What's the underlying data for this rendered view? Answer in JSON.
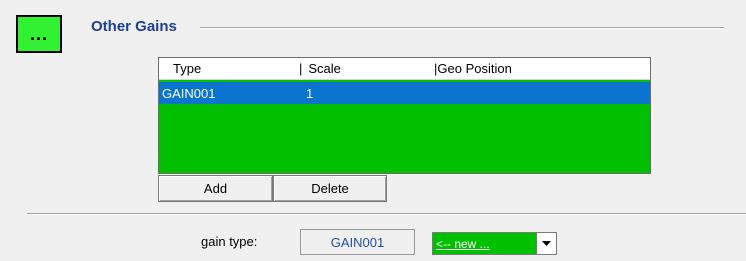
{
  "group": {
    "title": "Other Gains",
    "menu_button_label": "..."
  },
  "listview": {
    "columns": [
      {
        "label": "Type",
        "separator": ""
      },
      {
        "label": "Scale",
        "separator": "|"
      },
      {
        "label": "Geo Position",
        "separator": "|"
      }
    ],
    "rows": [
      {
        "type": "GAIN001",
        "scale": "1",
        "geo_position": "",
        "selected": true
      }
    ],
    "background_color": "#00c000",
    "selection_color": "#0a74cf"
  },
  "buttons": {
    "add_label": "Add",
    "delete_label": "Delete"
  },
  "gain_type": {
    "label": "gain type:",
    "value": "GAIN001"
  },
  "combo": {
    "selected": "<-- new ...",
    "arrow_icon": "chevron-down-icon"
  },
  "colors": {
    "accent_green": "#32f032",
    "title_blue": "#1f3f96"
  }
}
